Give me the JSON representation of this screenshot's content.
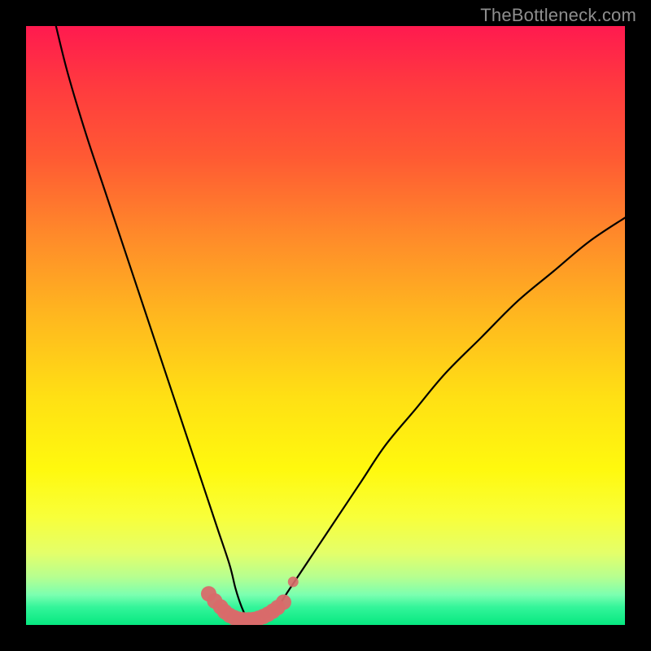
{
  "watermark": "TheBottleneck.com",
  "colors": {
    "frame": "#000000",
    "curve": "#000000",
    "marker": "#d96a6a",
    "gradient_top": "#ff1a4f",
    "gradient_bottom": "#06e880"
  },
  "chart_data": {
    "type": "line",
    "title": "",
    "xlabel": "",
    "ylabel": "",
    "xlim": [
      0,
      100
    ],
    "ylim": [
      0,
      100
    ],
    "series": [
      {
        "name": "bottleneck-curve",
        "x": [
          5,
          7,
          10,
          13,
          16,
          19,
          22,
          25,
          28,
          30,
          32,
          34,
          35,
          36,
          37,
          38,
          39,
          40,
          42,
          44,
          48,
          52,
          56,
          60,
          65,
          70,
          76,
          82,
          88,
          94,
          100
        ],
        "y": [
          100,
          92,
          82,
          73,
          64,
          55,
          46,
          37,
          28,
          22,
          16,
          10,
          6,
          3,
          1,
          0.5,
          0.5,
          1,
          3,
          6,
          12,
          18,
          24,
          30,
          36,
          42,
          48,
          54,
          59,
          64,
          68
        ]
      }
    ],
    "markers": {
      "name": "highlight-dots",
      "x": [
        30.5,
        31.5,
        32.5,
        33.2,
        34.0,
        34.8,
        35.6,
        36.4,
        37.2,
        38.0,
        38.8,
        39.6,
        40.4,
        41.2,
        42.0,
        43.0,
        44.6
      ],
      "y": [
        5.2,
        4.0,
        3.0,
        2.2,
        1.6,
        1.2,
        0.95,
        0.85,
        0.85,
        0.9,
        1.1,
        1.4,
        1.8,
        2.3,
        2.9,
        3.8,
        7.2
      ]
    }
  }
}
